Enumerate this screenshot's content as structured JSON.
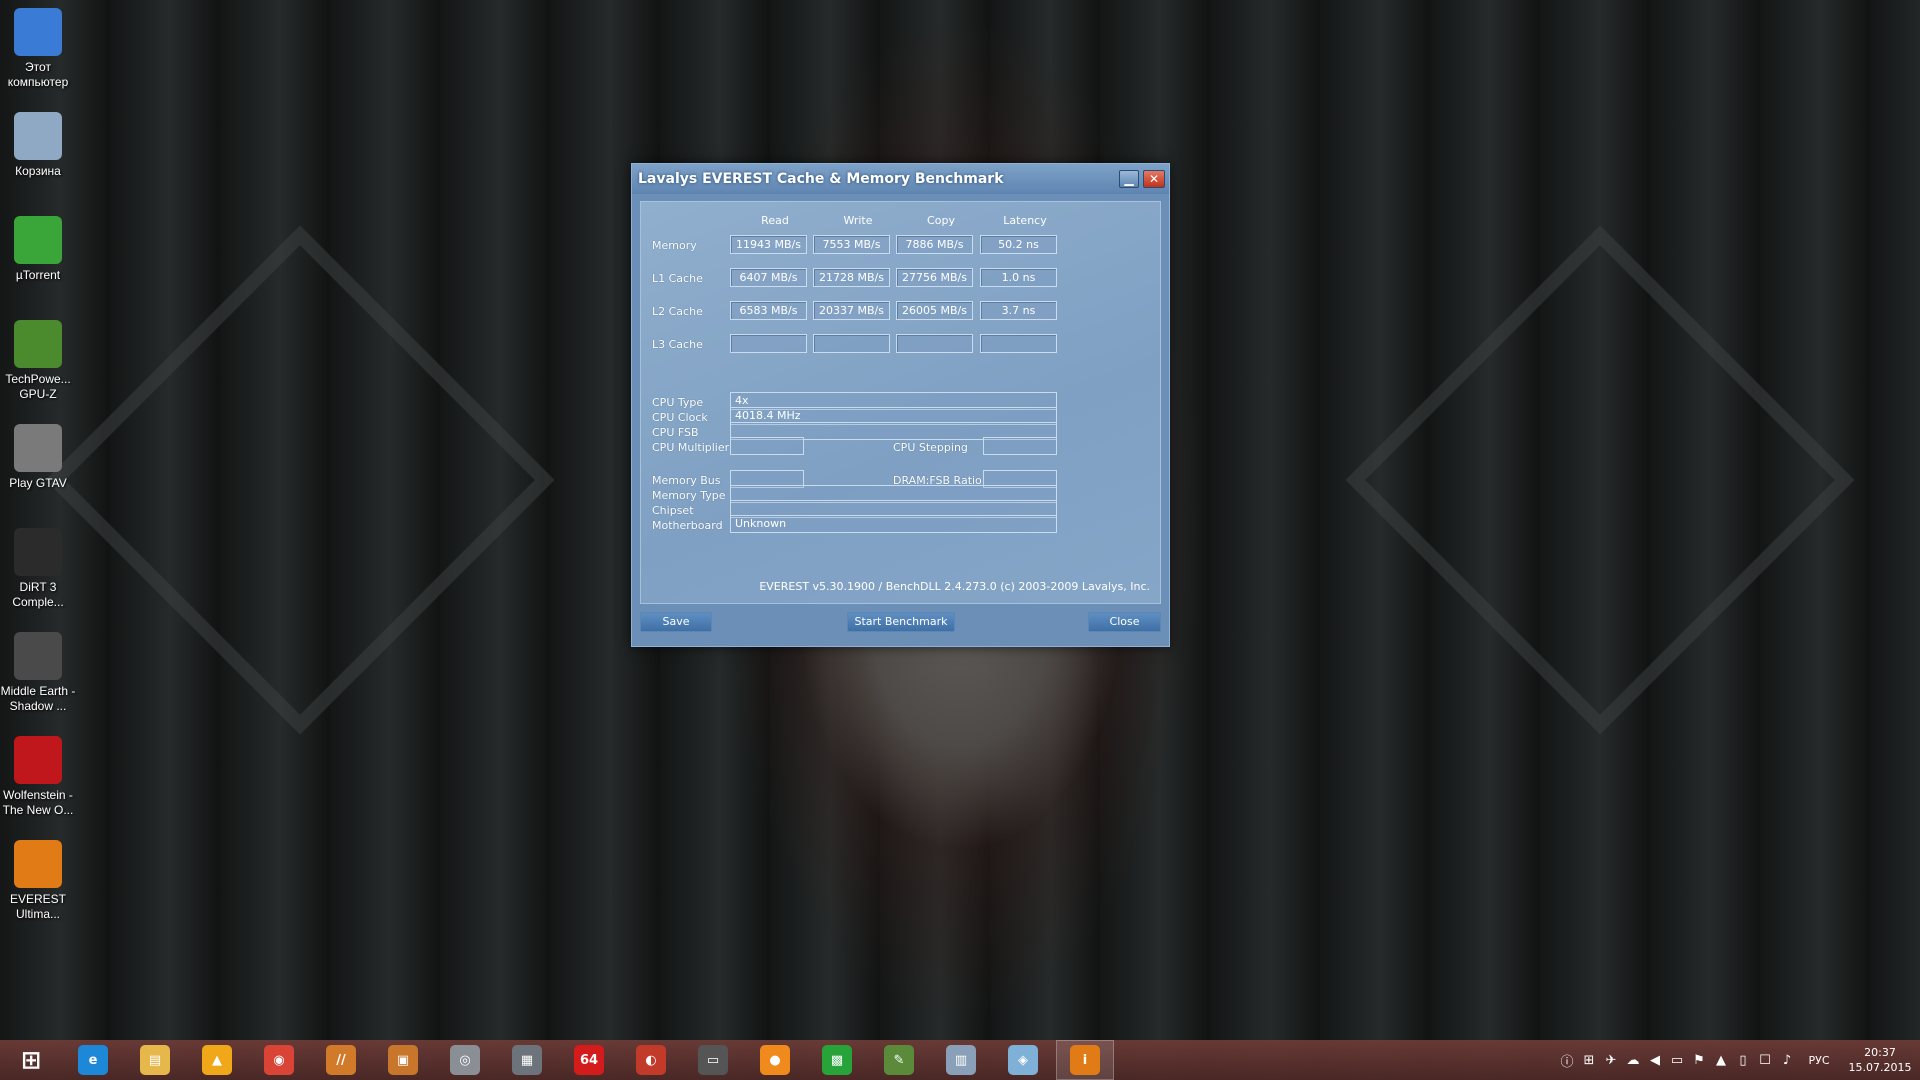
{
  "desktop_icons": [
    {
      "label": "Этот компьютер",
      "icon": "computer-icon",
      "color": "#3a7bd5"
    },
    {
      "label": "Корзина",
      "icon": "recycle-bin-icon",
      "color": "#8fa9c4"
    },
    {
      "label": "µTorrent",
      "icon": "utorrent-icon",
      "color": "#3aa63a"
    },
    {
      "label": "TechPowe... GPU-Z",
      "icon": "gpuz-icon",
      "color": "#4c8a2e"
    },
    {
      "label": "Play GTAV",
      "icon": "gtav-icon",
      "color": "#7a7a7a"
    },
    {
      "label": "DiRT 3 Comple...",
      "icon": "dirt3-icon",
      "color": "#2b2b2b"
    },
    {
      "label": "Middle Earth - Shadow ...",
      "icon": "middle-earth-icon",
      "color": "#4a4a4a"
    },
    {
      "label": "Wolfenstein - The New O...",
      "icon": "wolfenstein-icon",
      "color": "#c0171c"
    },
    {
      "label": "EVEREST Ultima...",
      "icon": "everest-icon",
      "color": "#e07b16"
    }
  ],
  "window": {
    "title": "Lavalys EVEREST Cache & Memory Benchmark",
    "minimize_glyph": "▁",
    "close_glyph": "✕",
    "columns": [
      "Read",
      "Write",
      "Copy",
      "Latency"
    ],
    "rows": [
      {
        "label": "Memory",
        "values": [
          "11943 MB/s",
          "7553 MB/s",
          "7886 MB/s",
          "50.2 ns"
        ]
      },
      {
        "label": "L1 Cache",
        "values": [
          "6407 MB/s",
          "21728 MB/s",
          "27756 MB/s",
          "1.0 ns"
        ]
      },
      {
        "label": "L2 Cache",
        "values": [
          "6583 MB/s",
          "20337 MB/s",
          "26005 MB/s",
          "3.7 ns"
        ]
      },
      {
        "label": "L3 Cache",
        "values": [
          "",
          "",
          "",
          ""
        ]
      }
    ],
    "cpu": {
      "cpu_type_label": "CPU Type",
      "cpu_type": "4x",
      "cpu_clock_label": "CPU Clock",
      "cpu_clock": "4018.4 MHz",
      "cpu_fsb_label": "CPU FSB",
      "cpu_fsb": "",
      "cpu_multiplier_label": "CPU Multiplier",
      "cpu_multiplier": "",
      "cpu_stepping_label": "CPU Stepping",
      "cpu_stepping": ""
    },
    "mem": {
      "memory_bus_label": "Memory Bus",
      "memory_bus": "",
      "dram_fsb_label": "DRAM:FSB Ratio",
      "dram_fsb": "",
      "memory_type_label": "Memory Type",
      "memory_type": "",
      "chipset_label": "Chipset",
      "chipset": "",
      "motherboard_label": "Motherboard",
      "motherboard": "Unknown"
    },
    "footer": "EVEREST v5.30.1900 / BenchDLL 2.4.273.0  (c) 2003-2009 Lavalys, Inc.",
    "buttons": {
      "save": "Save",
      "start": "Start Benchmark",
      "close": "Close"
    }
  },
  "taskbar": {
    "items": [
      {
        "name": "start-button",
        "icon": "windows-logo-icon",
        "glyph": "⊞",
        "color": "transparent"
      },
      {
        "name": "taskbar-ie",
        "icon": "internet-explorer-icon",
        "glyph": "e",
        "color": "#1e88d8"
      },
      {
        "name": "taskbar-explorer",
        "icon": "folder-icon",
        "glyph": "▤",
        "color": "#e6b84c"
      },
      {
        "name": "taskbar-aimp",
        "icon": "aimp-icon",
        "glyph": "▲",
        "color": "#f0a818"
      },
      {
        "name": "taskbar-chrome",
        "icon": "chrome-icon",
        "glyph": "◉",
        "color": "#d94436"
      },
      {
        "name": "taskbar-app5",
        "icon": "app-icon",
        "glyph": "//",
        "color": "#d07a2a"
      },
      {
        "name": "taskbar-archive",
        "icon": "archive-icon",
        "glyph": "▣",
        "color": "#c8762b"
      },
      {
        "name": "taskbar-app7",
        "icon": "camera-icon",
        "glyph": "◎",
        "color": "#8a8f96"
      },
      {
        "name": "taskbar-app8",
        "icon": "grid-icon",
        "glyph": "▦",
        "color": "#6d737a"
      },
      {
        "name": "taskbar-aida64",
        "icon": "aida64-icon",
        "glyph": "64",
        "color": "#d41c1c"
      },
      {
        "name": "taskbar-app10",
        "icon": "swirl-icon",
        "glyph": "◐",
        "color": "#c23a2a"
      },
      {
        "name": "taskbar-monitor",
        "icon": "monitor-icon",
        "glyph": "▭",
        "color": "#555"
      },
      {
        "name": "taskbar-app12",
        "icon": "orange-ball-icon",
        "glyph": "●",
        "color": "#f08a1c"
      },
      {
        "name": "taskbar-store",
        "icon": "store-icon",
        "glyph": "▩",
        "color": "#27a33a"
      },
      {
        "name": "taskbar-app14",
        "icon": "pen-icon",
        "glyph": "✎",
        "color": "#5a8a3a"
      },
      {
        "name": "taskbar-app15",
        "icon": "chart-window-icon",
        "glyph": "▥",
        "color": "#8aa0b8"
      },
      {
        "name": "taskbar-app16",
        "icon": "blue-window-icon",
        "glyph": "◈",
        "color": "#7fb0d8"
      },
      {
        "name": "taskbar-everest",
        "icon": "everest-icon",
        "glyph": "i",
        "color": "#e07b16",
        "active": true
      }
    ],
    "tray": {
      "icons": [
        "info-tray-icon",
        "windows-tray-icon",
        "network-tray-icon",
        "cloud-tray-icon",
        "speaker-mute-tray-icon",
        "display-tray-icon",
        "flag-tray-icon",
        "nvidia-tray-icon",
        "tablet-tray-icon",
        "network2-tray-icon",
        "volume-tray-icon"
      ],
      "glyphs": [
        "ⓘ",
        "⊞",
        "✈",
        "☁",
        "◀",
        "▭",
        "⚑",
        "▲",
        "▯",
        "☐",
        "♪"
      ],
      "language": "РУС",
      "time": "20:37",
      "date": "15.07.2015"
    }
  }
}
